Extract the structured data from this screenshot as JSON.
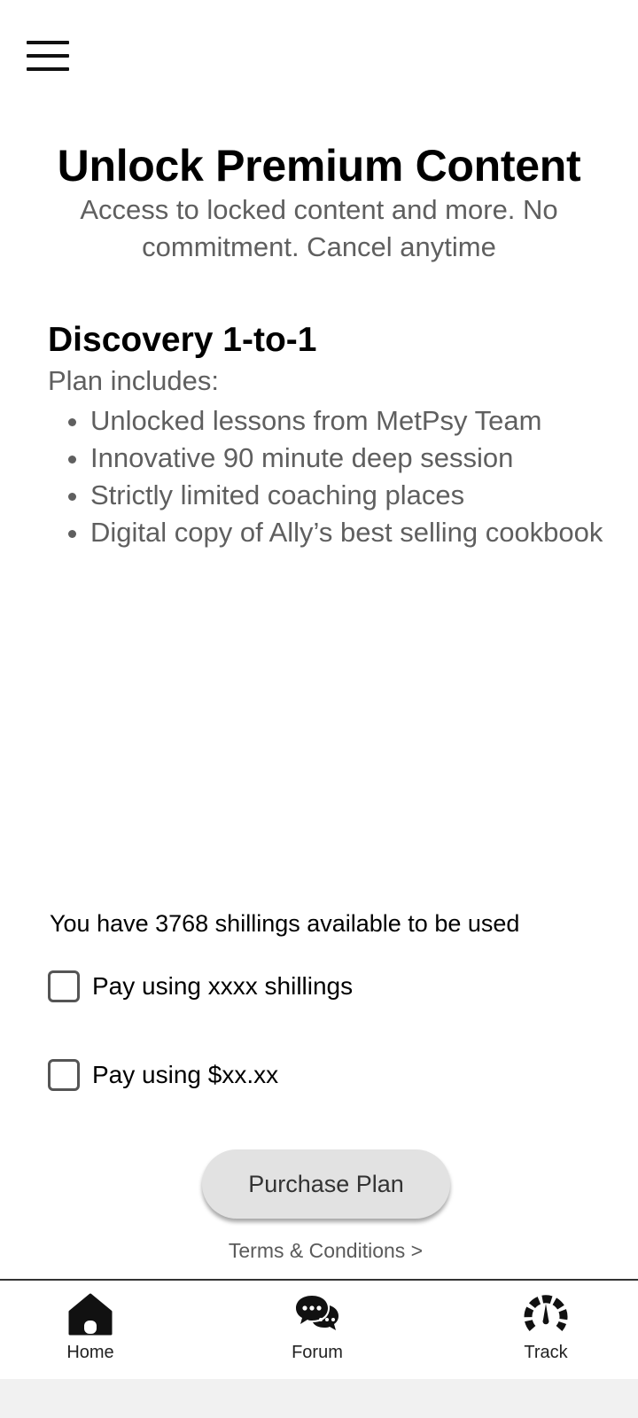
{
  "header": {
    "menu_icon": "hamburger-menu-icon"
  },
  "hero": {
    "title": "Unlock Premium Content",
    "subtitle": "Access to locked content and more. No commitment. Cancel anytime"
  },
  "plan": {
    "name": "Discovery 1-to-1",
    "includes_label": "Plan includes:",
    "features": [
      "Unlocked lessons from MetPsy Team",
      "Innovative 90 minute deep session",
      "Strictly limited coaching places",
      "Digital copy of Ally’s best selling cookbook"
    ]
  },
  "payment": {
    "shillings_note": "You have 3768 shillings available to be used",
    "options": [
      {
        "label": "Pay using xxxx shillings",
        "checked": false
      },
      {
        "label": "Pay using $xx.xx",
        "checked": false
      }
    ],
    "purchase_label": "Purchase Plan",
    "terms_label": "Terms & Conditions >"
  },
  "bottom_nav": {
    "items": [
      {
        "label": "Home",
        "icon": "home-icon"
      },
      {
        "label": "Forum",
        "icon": "chat-bubbles-icon"
      },
      {
        "label": "Track",
        "icon": "speedometer-icon"
      }
    ]
  },
  "colors": {
    "text_primary": "#000000",
    "text_secondary": "#5f5f5f",
    "button_bg": "#e2e2e2",
    "nav_border": "#333333"
  }
}
